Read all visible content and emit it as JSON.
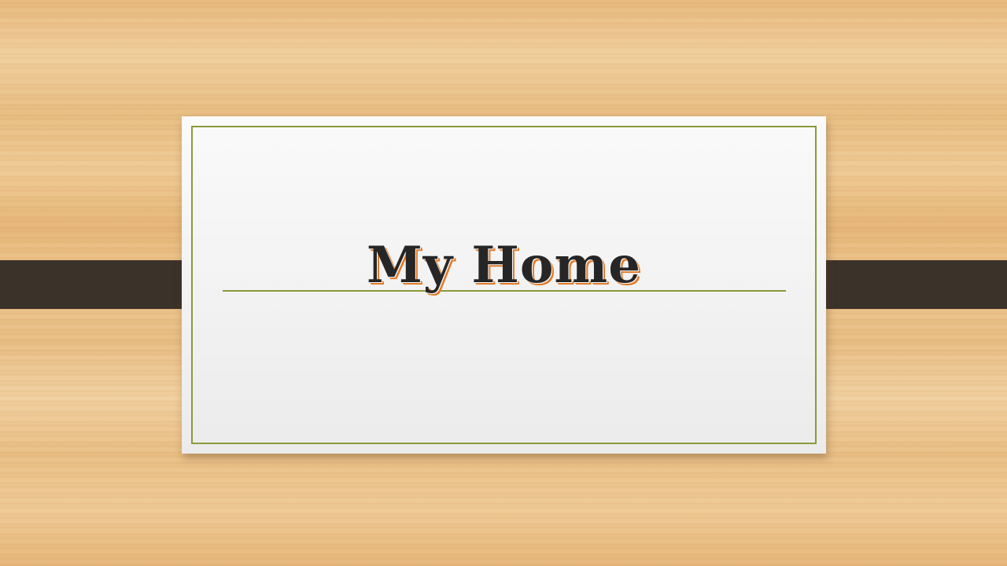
{
  "slide": {
    "title": "My Home"
  },
  "colors": {
    "background_wood": "#ecc38a",
    "band": "#3b3229",
    "card": "#f5f5f5",
    "border_accent": "#8a9a3a",
    "title_text": "#262626",
    "title_shadow": "#e07b2a"
  }
}
